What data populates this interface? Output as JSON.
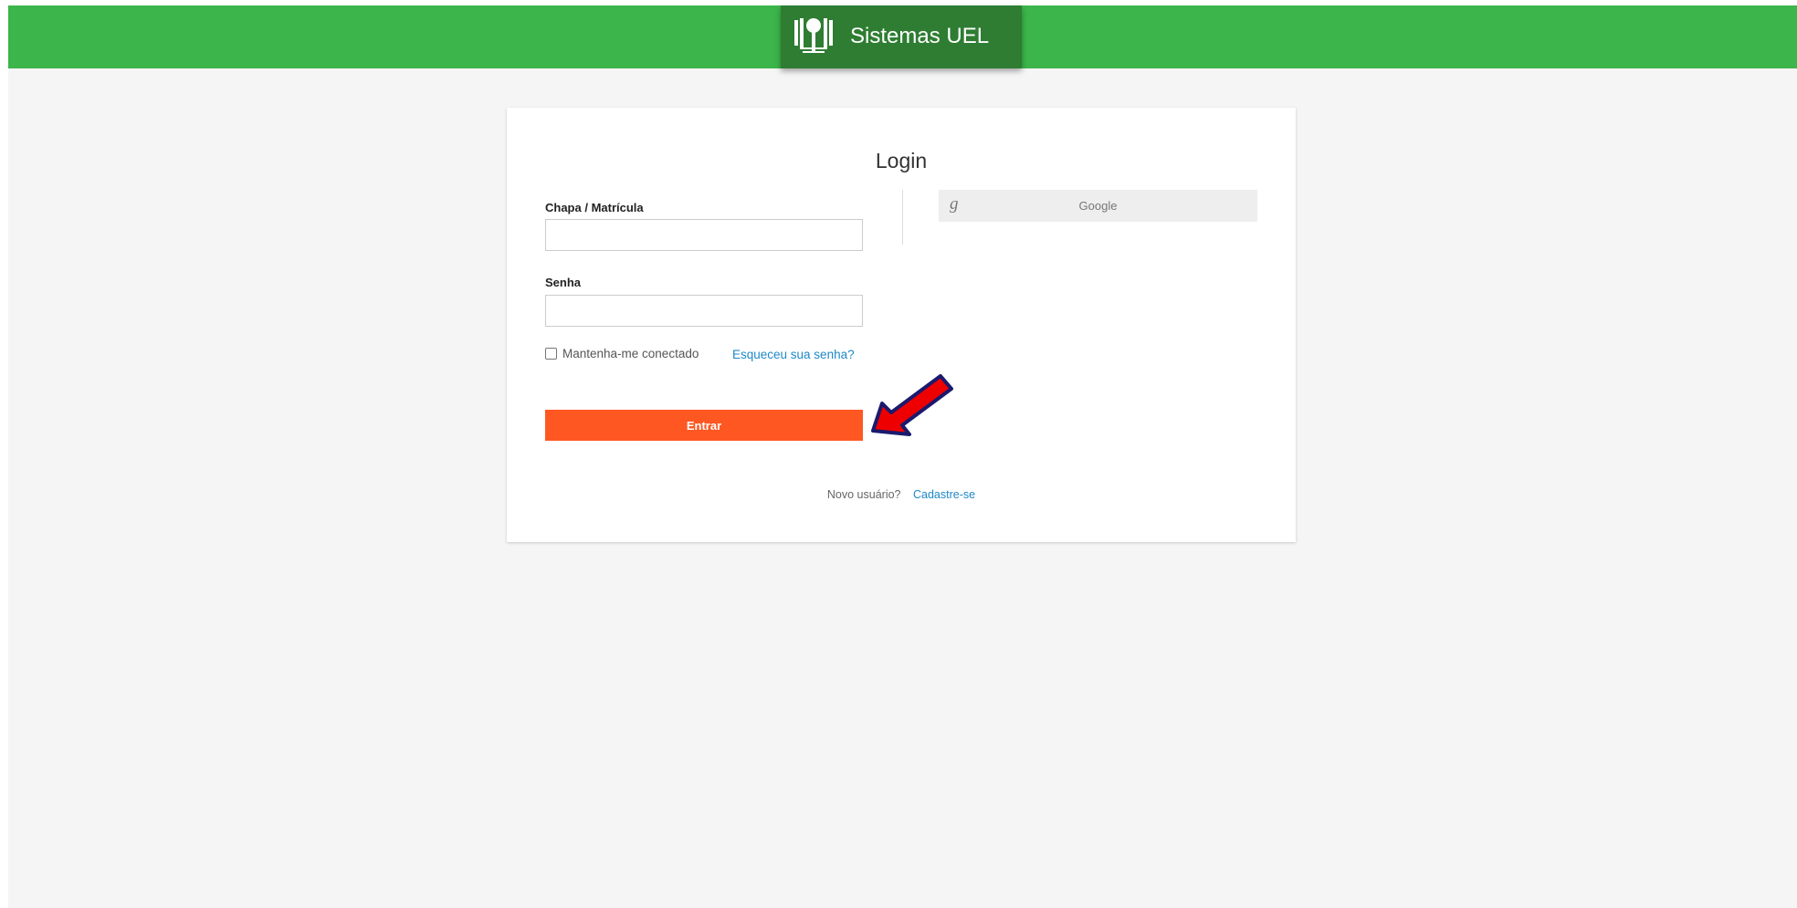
{
  "header": {
    "app_name": "Sistemas UEL",
    "logo_icon": "uel-logo-icon",
    "bar_color": "#3cb54a",
    "brand_color": "#2e7d32"
  },
  "login": {
    "title": "Login",
    "username_label": "Chapa / Matrícula",
    "username_value": "",
    "password_label": "Senha",
    "password_value": "",
    "remember_label": "Mantenha-me conectado",
    "remember_checked": false,
    "forgot_link": "Esqueceu sua senha?",
    "submit_label": "Entrar",
    "submit_color": "#ff5722",
    "google_icon": "google-g-icon",
    "google_icon_glyph": "g",
    "google_label": "Google",
    "signup_prompt": "Novo usuário?",
    "signup_link": "Cadastre-se",
    "link_color": "#1e88c8"
  },
  "annotation": {
    "icon": "red-arrow-icon",
    "color": "#ee0000"
  }
}
